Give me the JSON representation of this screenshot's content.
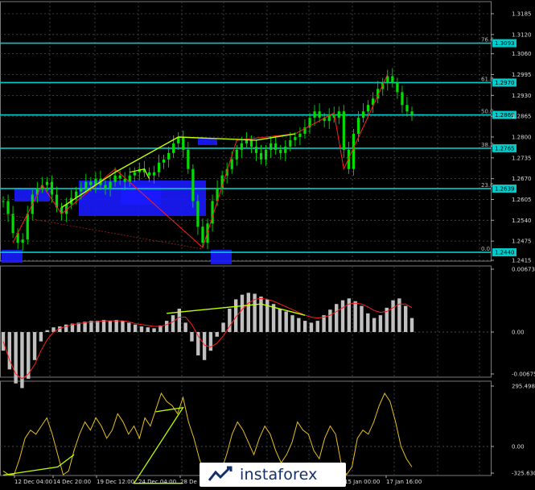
{
  "chart_data": [
    {
      "type": "line",
      "panel": "price",
      "y_ticks": [
        "1.3185",
        "1.3120",
        "1.3060",
        "1.2995",
        "1.2930",
        "1.2865",
        "1.2800",
        "1.2735",
        "1.2670",
        "1.2605",
        "1.2540",
        "1.2475",
        "1.2415"
      ],
      "ylim": [
        1.2415,
        1.3185
      ],
      "fib_levels": [
        {
          "label": "76.4",
          "value": 1.3093,
          "box": "1.3093"
        },
        {
          "label": "61.8",
          "value": 1.297,
          "box": "1.2970"
        },
        {
          "label": "50.0",
          "value": 1.2869,
          "box": "1.2869"
        },
        {
          "label": "38.2",
          "value": 1.2765,
          "box": "1.2765"
        },
        {
          "label": "23.6",
          "value": 1.2639,
          "box": "1.2639"
        },
        {
          "label": "0.0",
          "value": 1.244,
          "box": "1.2440"
        }
      ],
      "x_labels": [
        "12 Dec 04:00",
        "14 Dec 20:00",
        "19 Dec 12:00",
        "24 Dec 04:00",
        "28 De",
        "15 Jan 00:00",
        "17 Jan 16:00"
      ],
      "close_series": [
        1.26,
        1.256,
        1.25,
        1.247,
        1.248,
        1.256,
        1.262,
        1.264,
        1.265,
        1.266,
        1.262,
        1.258,
        1.256,
        1.259,
        1.261,
        1.263,
        1.264,
        1.266,
        1.265,
        1.267,
        1.265,
        1.264,
        1.266,
        1.268,
        1.267,
        1.266,
        1.268,
        1.269,
        1.27,
        1.269,
        1.268,
        1.269,
        1.272,
        1.273,
        1.275,
        1.278,
        1.28,
        1.276,
        1.27,
        1.26,
        1.252,
        1.247,
        1.253,
        1.26,
        1.264,
        1.268,
        1.27,
        1.273,
        1.276,
        1.278,
        1.279,
        1.277,
        1.275,
        1.273,
        1.276,
        1.278,
        1.276,
        1.275,
        1.277,
        1.279,
        1.28,
        1.281,
        1.283,
        1.286,
        1.288,
        1.286,
        1.285,
        1.287,
        1.286,
        1.288,
        1.276,
        1.27,
        1.281,
        1.286,
        1.288,
        1.29,
        1.292,
        1.295,
        1.297,
        1.299,
        1.297,
        1.294,
        1.29,
        1.288,
        1.287
      ]
    },
    {
      "type": "bar",
      "panel": "oscillator",
      "y_ticks": [
        "0.00673",
        "0.00",
        "-0.00675"
      ],
      "ylim": [
        -0.00675,
        0.00673
      ],
      "values": [
        -0.002,
        -0.004,
        -0.0055,
        -0.006,
        -0.005,
        -0.003,
        -0.001,
        0.0002,
        0.0005,
        0.0006,
        0.0008,
        0.0009,
        0.001,
        0.0011,
        0.0012,
        0.0012,
        0.0013,
        0.0012,
        0.0013,
        0.0012,
        0.001,
        0.0008,
        0.0006,
        0.0005,
        0.0004,
        0.0007,
        0.0012,
        0.0018,
        0.0025,
        0.001,
        -0.001,
        -0.0025,
        -0.003,
        -0.002,
        -0.0005,
        0.001,
        0.0025,
        0.0035,
        0.004,
        0.0042,
        0.0041,
        0.0038,
        0.0035,
        0.003,
        0.0025,
        0.0022,
        0.0018,
        0.0015,
        0.0012,
        0.001,
        0.0012,
        0.0018,
        0.0024,
        0.003,
        0.0034,
        0.0036,
        0.0033,
        0.0028,
        0.002,
        0.0015,
        0.0018,
        0.0026,
        0.0034,
        0.0036,
        0.0028,
        0.0015
      ],
      "signal": [
        -0.001,
        -0.003,
        -0.0045,
        -0.005,
        -0.0045,
        -0.0035,
        -0.002,
        -0.0008,
        0.0,
        0.0004,
        0.0006,
        0.0008,
        0.0009,
        0.001,
        0.0011,
        0.0011,
        0.0012,
        0.0012,
        0.0012,
        0.0012,
        0.0011,
        0.0009,
        0.0008,
        0.0007,
        0.0006,
        0.0006,
        0.0008,
        0.0011,
        0.0016,
        0.0016,
        0.0008,
        -0.0004,
        -0.0014,
        -0.0016,
        -0.0012,
        -0.0004,
        0.0006,
        0.0016,
        0.0024,
        0.0031,
        0.0035,
        0.0036,
        0.0035,
        0.0033,
        0.003,
        0.0027,
        0.0024,
        0.0021,
        0.0018,
        0.0016,
        0.0015,
        0.0016,
        0.0018,
        0.0022,
        0.0026,
        0.003,
        0.0031,
        0.003,
        0.0027,
        0.0023,
        0.0021,
        0.0022,
        0.0026,
        0.003,
        0.003,
        0.0026
      ]
    },
    {
      "type": "line",
      "panel": "cci",
      "y_ticks": [
        "295.4989",
        "0.00",
        "-325.6303"
      ],
      "ylim": [
        -325.6303,
        295.4989
      ],
      "values": [
        -120,
        -160,
        -140,
        -60,
        40,
        80,
        60,
        100,
        140,
        60,
        -40,
        -160,
        -120,
        -20,
        60,
        120,
        80,
        140,
        100,
        40,
        80,
        160,
        120,
        60,
        100,
        40,
        140,
        100,
        180,
        260,
        220,
        200,
        160,
        240,
        120,
        40,
        -60,
        -180,
        -260,
        -200,
        -120,
        -40,
        60,
        120,
        80,
        20,
        -40,
        40,
        100,
        60,
        -20,
        -80,
        -40,
        20,
        120,
        80,
        60,
        -20,
        -60,
        40,
        100,
        60,
        -80,
        -200,
        -100,
        40,
        80,
        60,
        120,
        200,
        260,
        220,
        120,
        0,
        -60,
        -100
      ]
    }
  ],
  "watermark": {
    "text": "instaforex"
  },
  "colors": {
    "fib": "#00cccc",
    "price": "#00dd00",
    "box": "#1a1aff",
    "wave": "#ff2020",
    "diverge": "#bfff00",
    "hist": "#c0c0c0",
    "signal": "#ff2020",
    "cci": "#e8c020"
  }
}
